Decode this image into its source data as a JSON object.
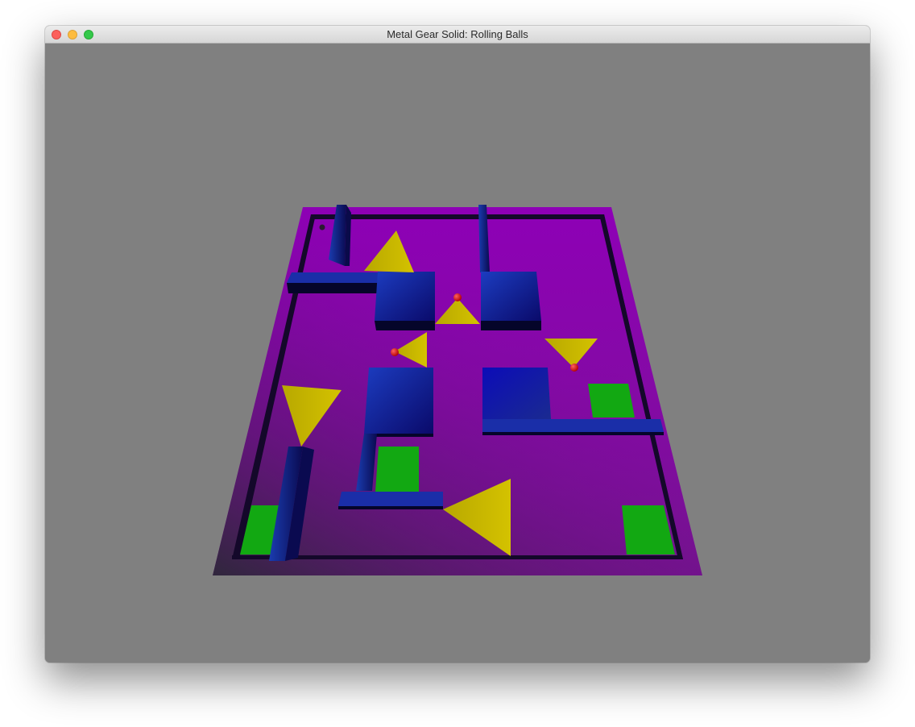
{
  "window": {
    "title": "Metal Gear Solid: Rolling Balls"
  },
  "scene": {
    "background_color": "#808080",
    "floor_color": "#8a00b0",
    "wall_color": "#1a1aa0",
    "goal_pad_color": "#10a810",
    "cone_color": "#c8b800",
    "enemy_ball_color": "#e00000",
    "goal_pad_count": 4,
    "vision_cone_count": 6,
    "enemy_ball_count": 3,
    "player_ball_count": 1
  }
}
